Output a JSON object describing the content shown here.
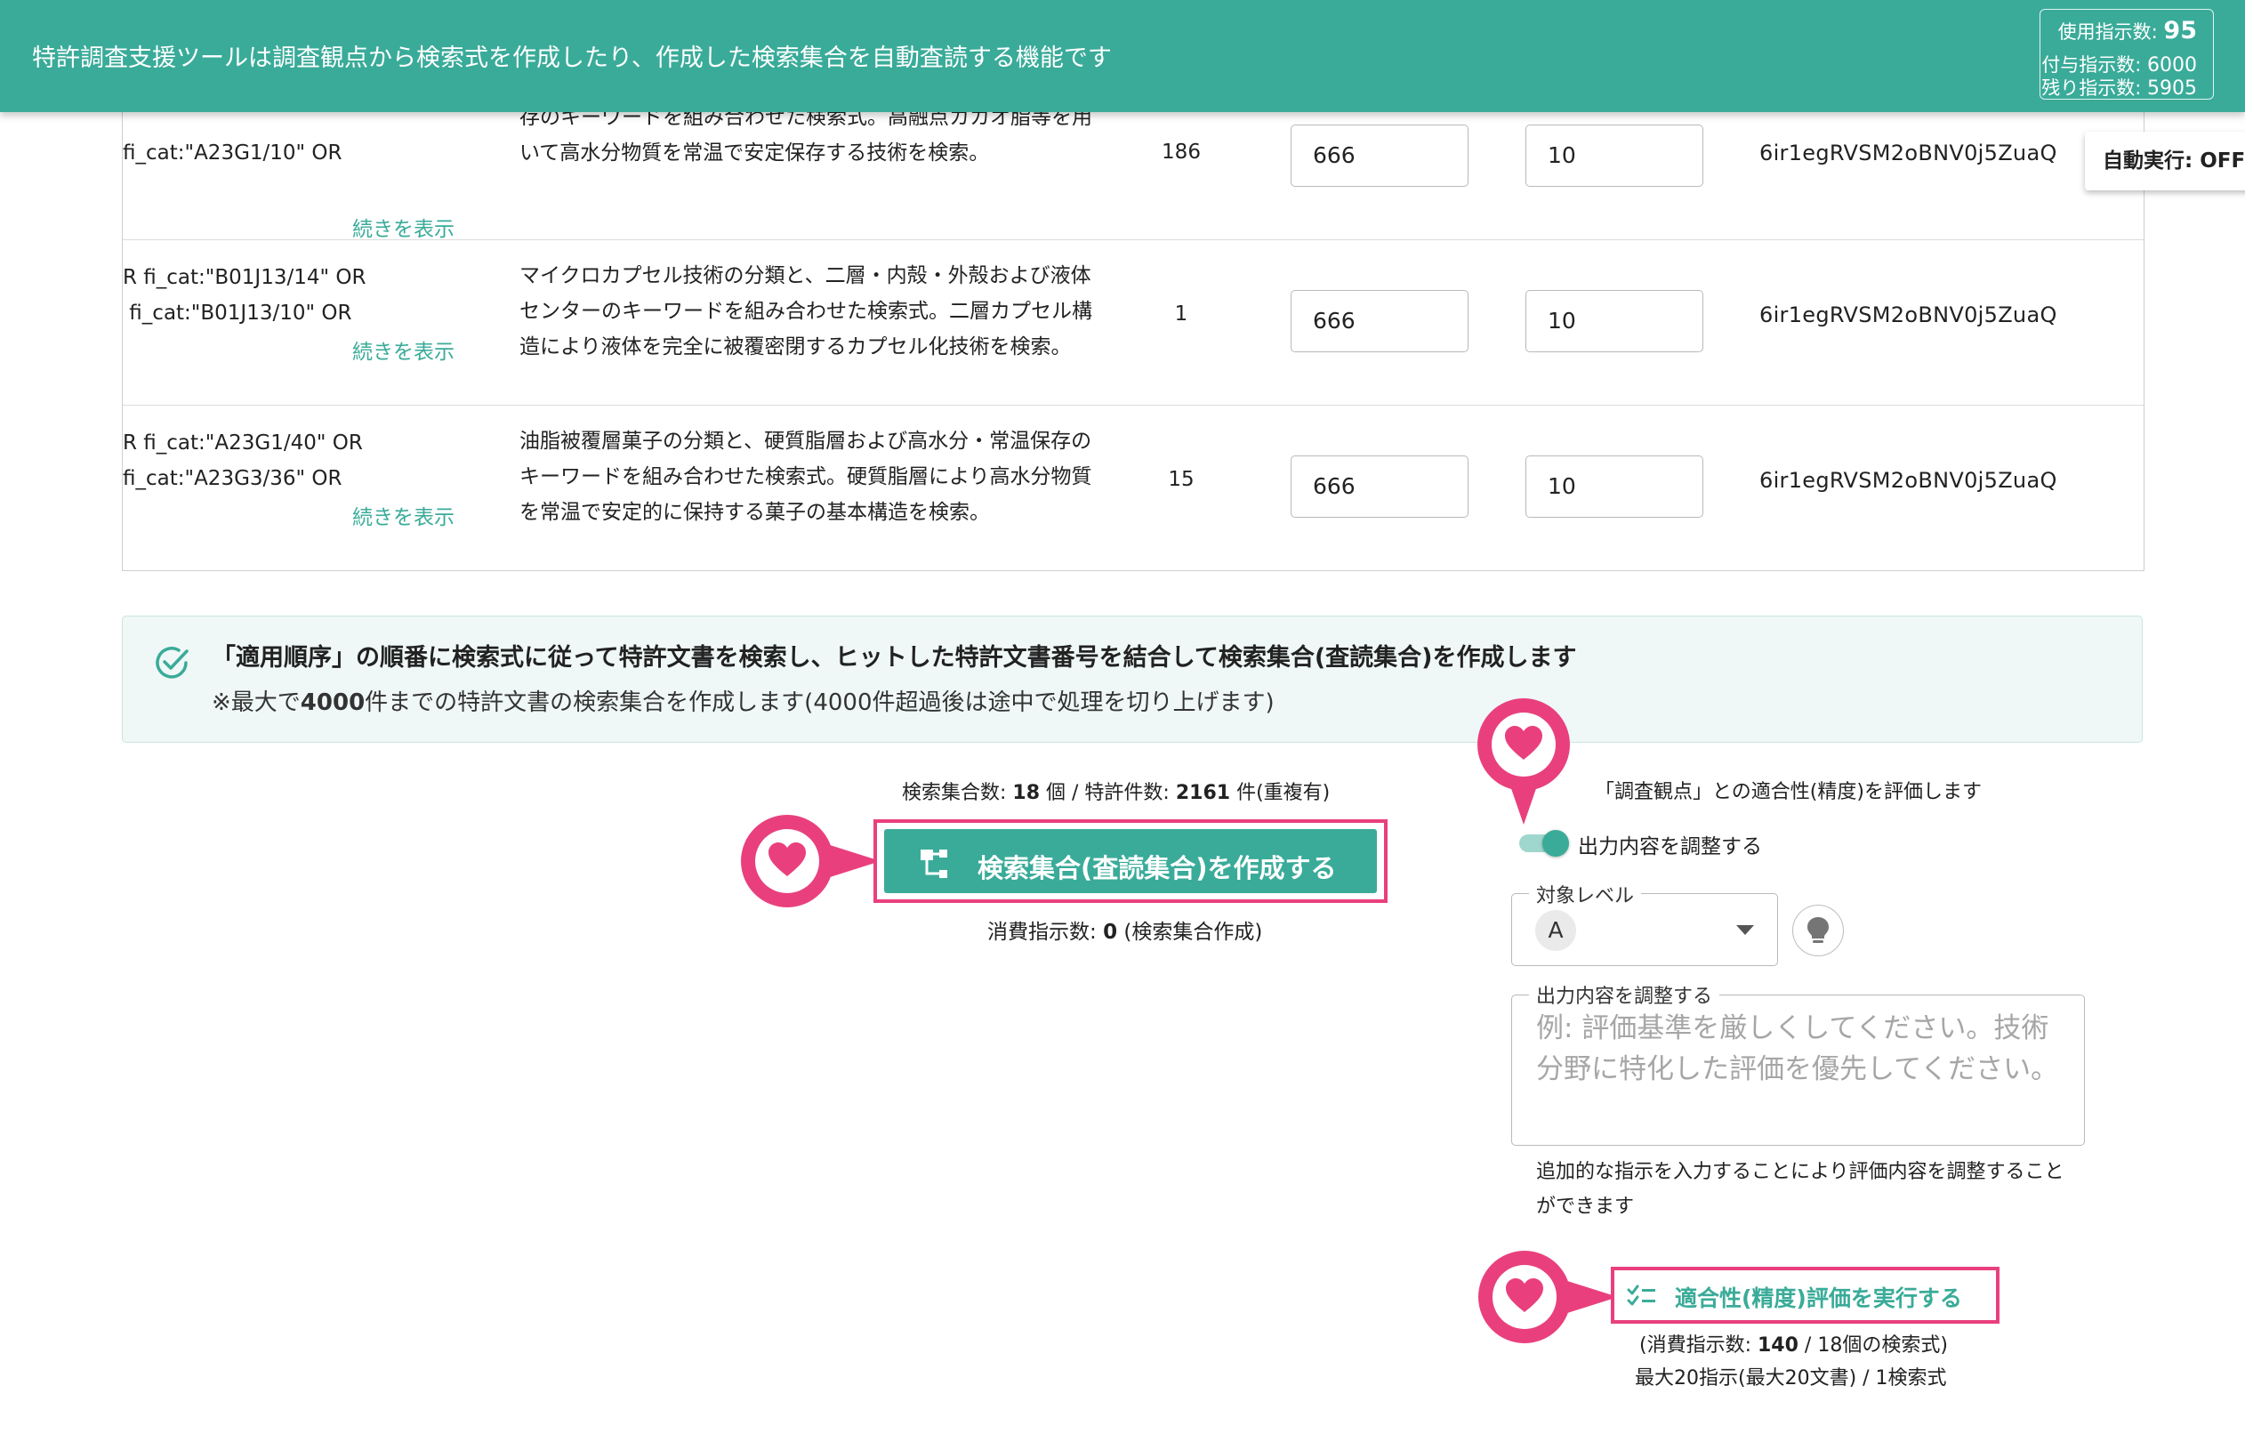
{
  "header": {
    "title": "特許調査支援ツールは調査観点から検索式を作成したり、作成した検索集合を自動査読する機能です",
    "usage": {
      "used_label": "使用指示数: ",
      "used_value": "95",
      "granted_label": "付与指示数: ",
      "granted_value": "6000",
      "remaining_label": "残り指示数: ",
      "remaining_value": "5905"
    }
  },
  "auto_exec": {
    "label": "自動実行: OFF"
  },
  "table": {
    "rows": [
      {
        "query": "fi_cat:\"A23G1/10\" OR",
        "more": "続きを表示",
        "description": "存のキーワードを組み合わせた検索式。高融点カカオ脂等を用いて高水分物質を常温で安定保存する技術を検索。",
        "count": "186",
        "input_a": "666",
        "input_b": "10",
        "id": "6ir1egRVSM2oBNV0j5ZuaQ"
      },
      {
        "query": "R fi_cat:\"B01J13/14\" OR\n fi_cat:\"B01J13/10\" OR",
        "more": "続きを表示",
        "description": "マイクロカプセル技術の分類と、二層・内殻・外殻および液体センターのキーワードを組み合わせた検索式。二層カプセル構造により液体を完全に被覆密閉するカプセル化技術を検索。",
        "count": "1",
        "input_a": "666",
        "input_b": "10",
        "id": "6ir1egRVSM2oBNV0j5ZuaQ"
      },
      {
        "query": "R fi_cat:\"A23G1/40\" OR\nfi_cat:\"A23G3/36\" OR",
        "more": "続きを表示",
        "description": "油脂被覆層菓子の分類と、硬質脂層および高水分・常温保存のキーワードを組み合わせた検索式。硬質脂層により高水分物質を常温で安定的に保持する菓子の基本構造を検索。",
        "count": "15",
        "input_a": "666",
        "input_b": "10",
        "id": "6ir1egRVSM2oBNV0j5ZuaQ"
      }
    ]
  },
  "info": {
    "main": "「適用順序」の順番に検索式に従って特許文書を検索し、ヒットした特許文書番号を結合して検索集合(査読集合)を作成します",
    "sub_prefix": "※最大で",
    "sub_bold": "4000",
    "sub_suffix": "件までの特許文書の検索集合を作成します(4000件超過後は途中で処理を切り上げます)"
  },
  "create": {
    "stats_label1": "検索集合数: ",
    "stats_value1": "18",
    "stats_mid": " 個 / 特許件数: ",
    "stats_value2": "2161",
    "stats_suffix": " 件(重複有)",
    "button_label": "検索集合(査読集合)を作成する",
    "consume_label": "消費指示数: ",
    "consume_value": "0",
    "consume_suffix": " (検索集合作成)"
  },
  "evaluate": {
    "title": "「調査観点」との適合性(精度)を評価します",
    "toggle_label": "出力内容を調整する",
    "toggle_on": true,
    "level_legend": "対象レベル",
    "level_value": "A",
    "adjust_legend": "出力内容を調整する",
    "adjust_placeholder": "例: 評価基準を厳しくしてください。技術分野に特化した評価を優先してください。",
    "adjust_help": "追加的な指示を入力することにより評価内容を調整することができます",
    "button_label": "適合性(精度)評価を実行する",
    "consume_prefix": "(消費指示数: ",
    "consume_value": "140",
    "consume_suffix": " / 18個の検索式)",
    "max_note": "最大20指示(最大20文書) / 1検索式"
  },
  "colors": {
    "primary": "#3aab99",
    "highlight": "#e9407d",
    "banner_bg": "#eff8f6"
  },
  "icons": [
    "check-circle-icon",
    "hierarchy-icon",
    "lightbulb-icon",
    "checklist-icon",
    "heart-marker-icon",
    "chevron-down-icon"
  ]
}
